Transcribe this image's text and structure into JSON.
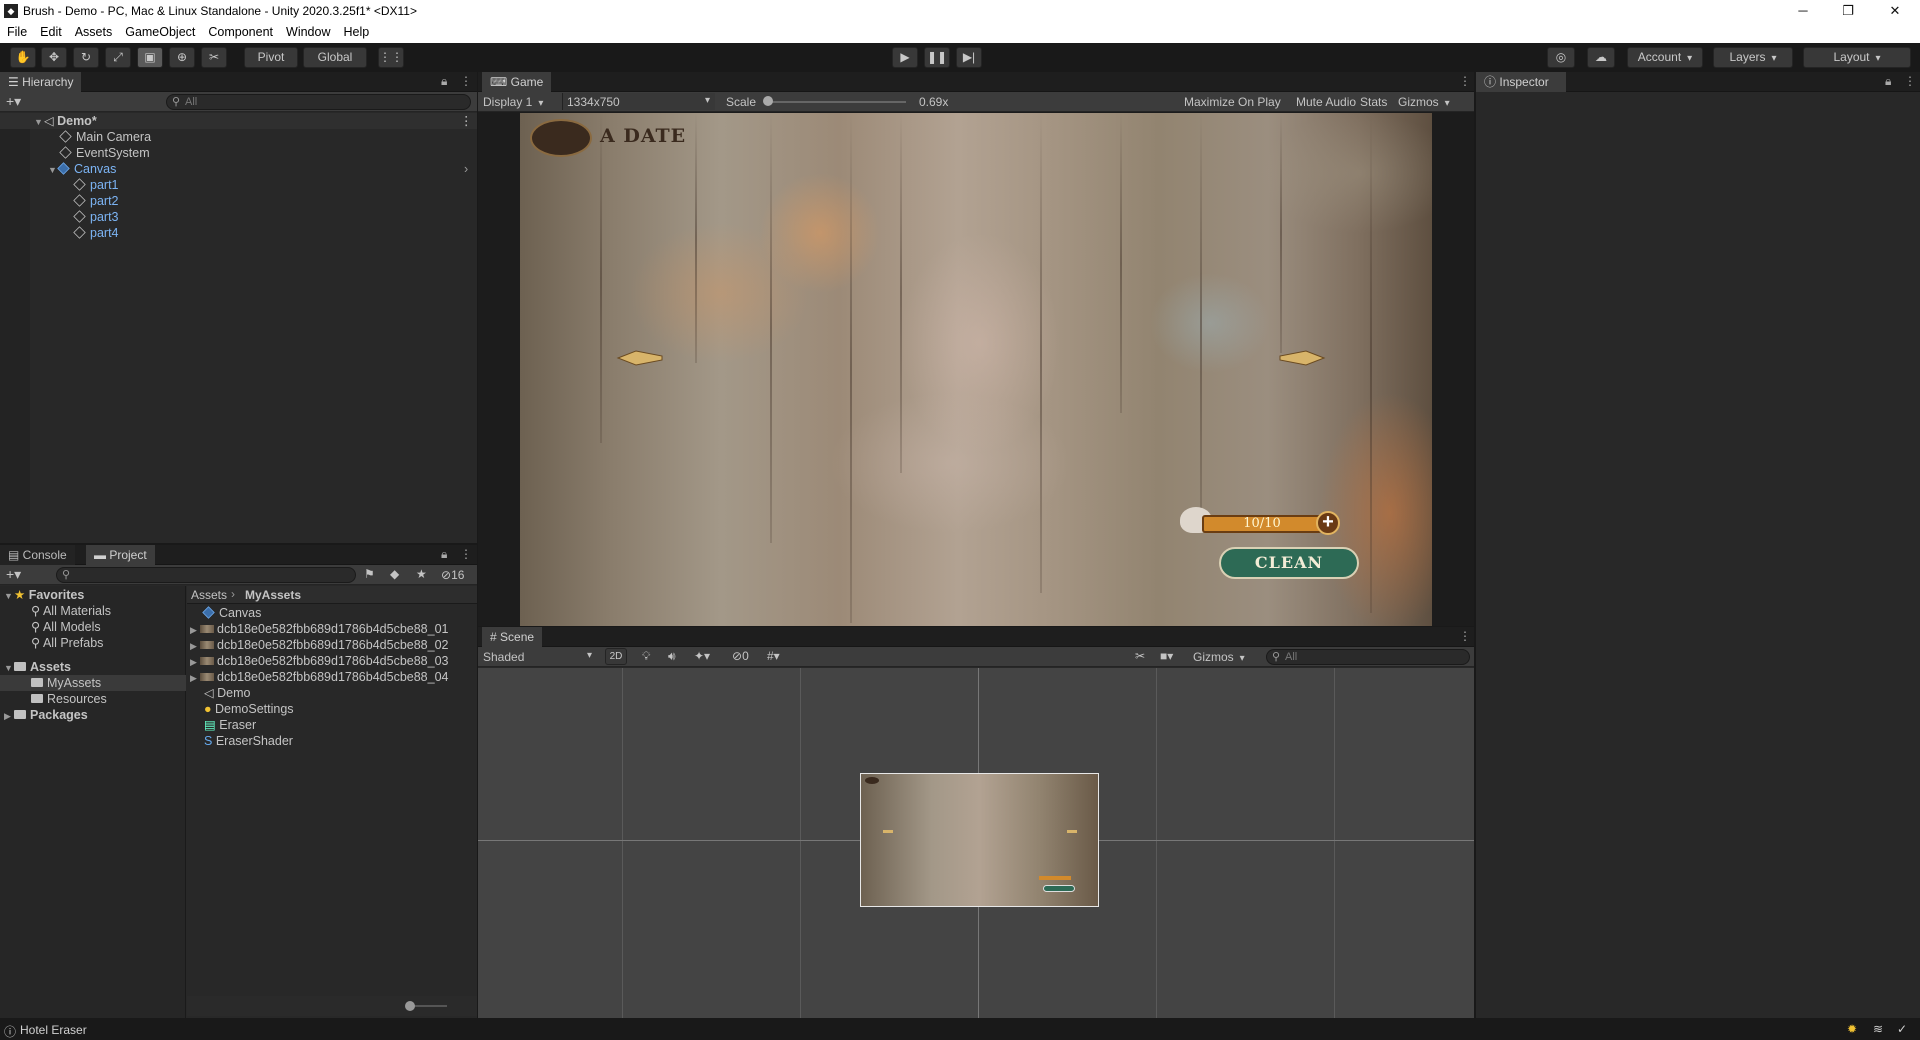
{
  "window": {
    "title": "Brush - Demo - PC, Mac & Linux Standalone - Unity 2020.3.25f1* <DX11>"
  },
  "menu": [
    "File",
    "Edit",
    "Assets",
    "GameObject",
    "Component",
    "Window",
    "Help"
  ],
  "toolbar": {
    "pivot": "Pivot",
    "global": "Global",
    "account": "Account",
    "layers": "Layers",
    "layout": "Layout"
  },
  "hierarchy": {
    "tab": "Hierarchy",
    "search_placeholder": "All",
    "scene": "Demo*",
    "items": [
      {
        "label": "Main Camera"
      },
      {
        "label": "EventSystem"
      },
      {
        "label": "Canvas"
      },
      {
        "label": "part1"
      },
      {
        "label": "part2"
      },
      {
        "label": "part3"
      },
      {
        "label": "part4"
      }
    ]
  },
  "game": {
    "tab": "Game",
    "display": "Display 1",
    "resolution": "1334x750",
    "scale_label": "Scale",
    "scale_value": "0.69x",
    "buttons": [
      "Maximize On Play",
      "Mute Audio",
      "Stats",
      "Gizmos"
    ],
    "logo_text": "A DATE",
    "energy": "10/10",
    "clean_button": "CLEAN"
  },
  "inspector": {
    "tab": "Inspector"
  },
  "project": {
    "tabs": [
      "Console",
      "Project"
    ],
    "hidden_count": "16",
    "favorites": {
      "label": "Favorites",
      "items": [
        "All Materials",
        "All Models",
        "All Prefabs"
      ]
    },
    "assets": {
      "label": "Assets",
      "items": [
        "MyAssets",
        "Resources"
      ]
    },
    "packages": "Packages",
    "breadcrumb": [
      "Assets",
      "MyAssets"
    ],
    "files": [
      "Canvas",
      "dcb18e0e582fbb689d1786b4d5cbe88_01",
      "dcb18e0e582fbb689d1786b4d5cbe88_02",
      "dcb18e0e582fbb689d1786b4d5cbe88_03",
      "dcb18e0e582fbb689d1786b4d5cbe88_04",
      "Demo",
      "DemoSettings",
      "Eraser",
      "EraserShader"
    ]
  },
  "scene": {
    "tab": "Scene",
    "shading": "Shaded",
    "mode_2d": "2D",
    "gizmos": "Gizmos",
    "hidden": "0",
    "search_placeholder": "All"
  },
  "status": {
    "text": "Hotel Eraser"
  }
}
